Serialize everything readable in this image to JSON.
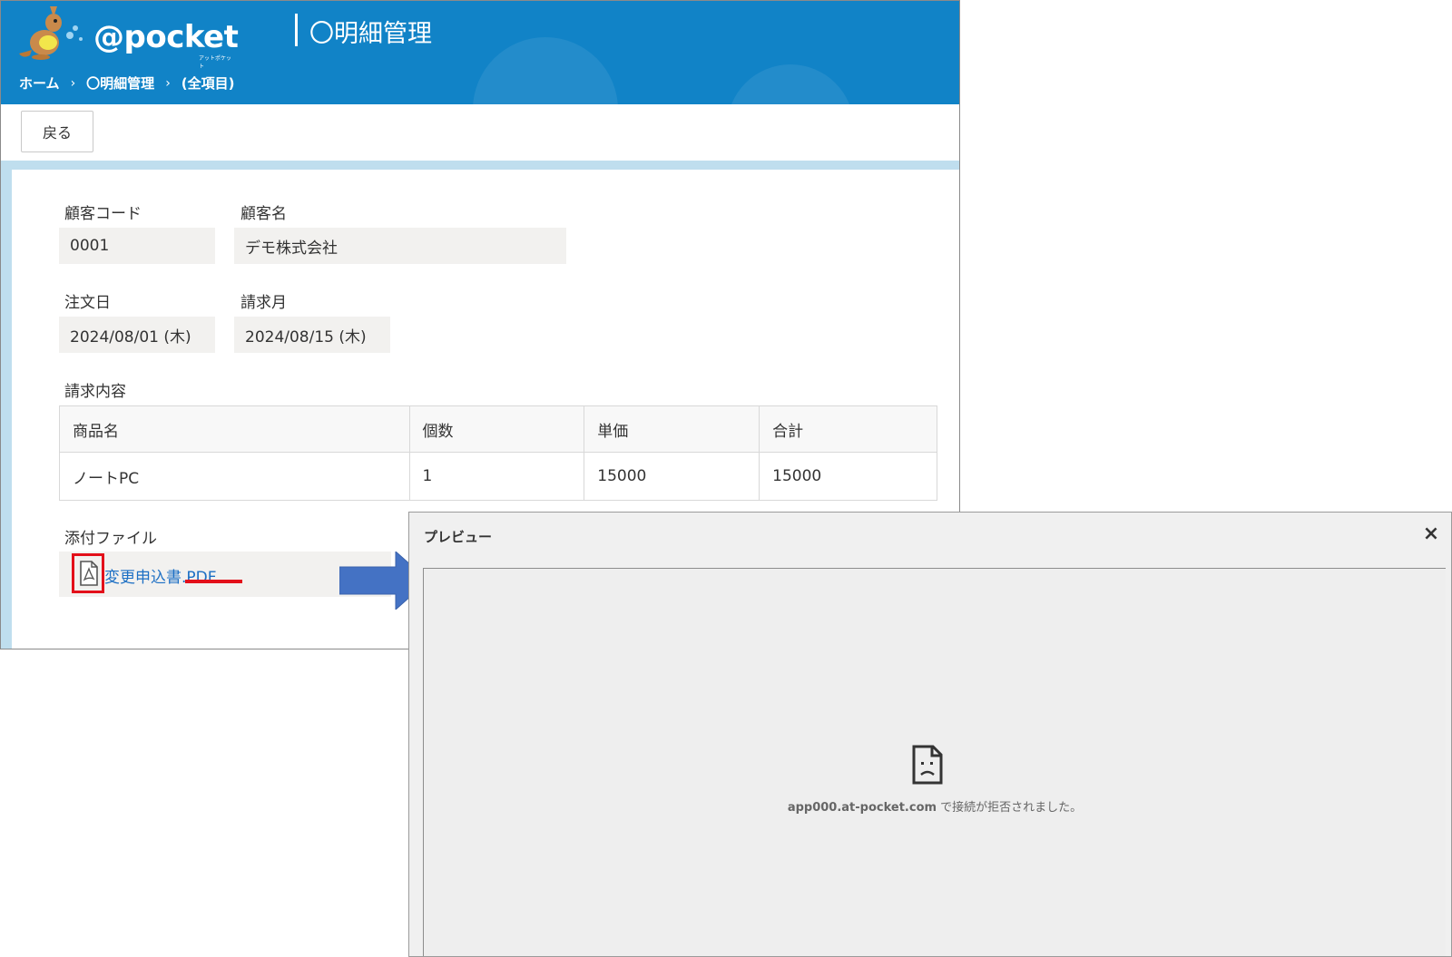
{
  "header": {
    "logo_text": "@pocket",
    "logo_subtext": "アットポケット",
    "title": "〇明細管理"
  },
  "breadcrumb": {
    "items": [
      "ホーム",
      "〇明細管理",
      "(全項目)"
    ],
    "separator": "›"
  },
  "toolbar": {
    "back_label": "戻る"
  },
  "form": {
    "customer_code": {
      "label": "顧客コード",
      "value": "0001"
    },
    "customer_name": {
      "label": "顧客名",
      "value": "デモ株式会社"
    },
    "order_date": {
      "label": "注文日",
      "value": "2024/08/01 (木)"
    },
    "billing_month": {
      "label": "請求月",
      "value": "2024/08/15 (木)"
    },
    "billing_details": {
      "label": "請求内容",
      "columns": [
        "商品名",
        "個数",
        "単価",
        "合計"
      ],
      "rows": [
        [
          "ノートPC",
          "1",
          "15000",
          "15000"
        ]
      ]
    },
    "attachments": {
      "label": "添付ファイル",
      "file_name": "変更申込書.PDF"
    }
  },
  "preview": {
    "title": "プレビュー",
    "close_label": "×",
    "error_host": "app000.at-pocket.com",
    "error_text": " で接続が拒否されました。"
  },
  "colors": {
    "header_blue": "#1183c7",
    "link_blue": "#1c6fc4",
    "highlight_red": "#e3101a",
    "arrow_blue": "#4472c4"
  }
}
